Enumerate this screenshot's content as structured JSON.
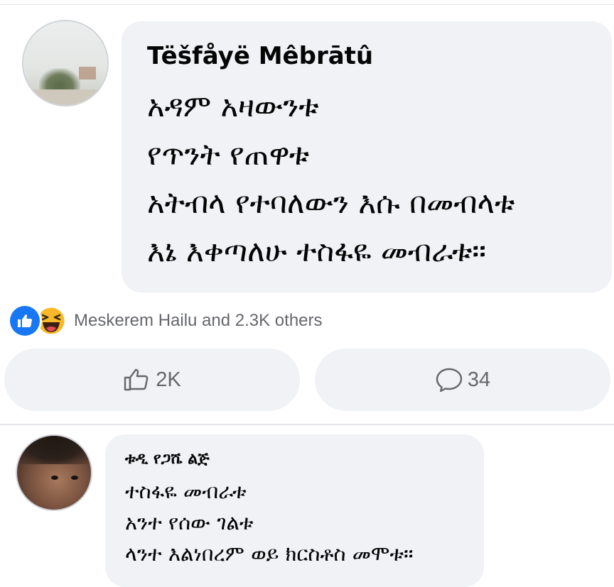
{
  "post_comment": {
    "author": "Tëšfåyë Mêbrātû",
    "lines": [
      "አዳም አዛውንቱ",
      "የጥንት የጠዋቱ",
      "አትብላ የተባለውን እሱ በመብላቱ",
      "እኔ እቀጣለሁ ተስፋዬ መብራቱ።"
    ]
  },
  "reactions": {
    "summary": "Meskerem Hailu and 2.3K others",
    "icons": [
      "like-icon",
      "haha-icon"
    ]
  },
  "actions": {
    "like_count": "2K",
    "comment_count": "34"
  },
  "reply_comment": {
    "author": "ቱዲ የጋሼ ልጅ",
    "lines": [
      "ተስፋዬ መብራቱ",
      "አንተ የሰው ገልቱ",
      "ላንተ እልነበረም ወይ ክርስቶስ መሞቱ።"
    ]
  },
  "colors": {
    "bubble": "#f0f2f5",
    "like_blue": "#1877f2",
    "muted_text": "#65676b"
  }
}
